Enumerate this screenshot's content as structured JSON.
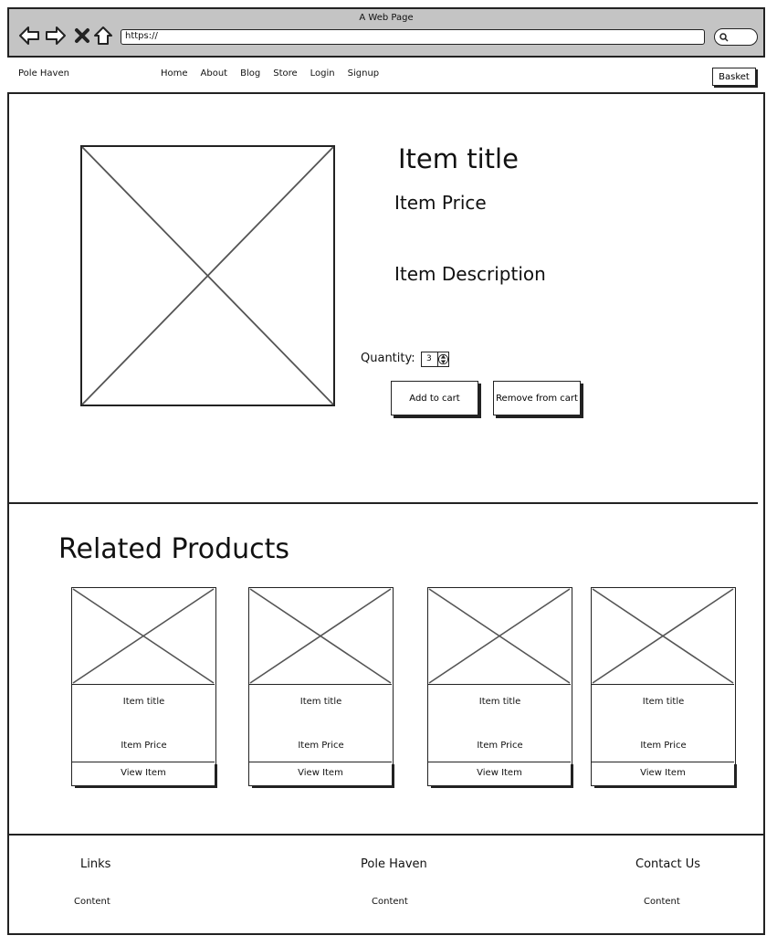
{
  "browser": {
    "window_title": "A Web Page",
    "url": "https://"
  },
  "nav": {
    "brand": "Pole Haven",
    "links": [
      "Home",
      "About",
      "Blog",
      "Store",
      "Login",
      "Signup"
    ],
    "basket_label": "Basket"
  },
  "product": {
    "title": "Item title",
    "price": "Item Price",
    "description": "Item Description",
    "quantity_label": "Quantity:",
    "quantity_value": "3",
    "add_label": "Add to cart",
    "remove_label": "Remove from cart"
  },
  "related": {
    "heading": "Related Products",
    "cards": [
      {
        "title": "Item title",
        "price": "Item Price",
        "view_label": "View Item"
      },
      {
        "title": "Item title",
        "price": "Item Price",
        "view_label": "View Item"
      },
      {
        "title": "Item title",
        "price": "Item Price",
        "view_label": "View Item"
      },
      {
        "title": "Item title",
        "price": "Item Price",
        "view_label": "View Item"
      }
    ]
  },
  "footer": {
    "columns": [
      {
        "heading": "Links",
        "content": "Content"
      },
      {
        "heading": "Pole Haven",
        "content": "Content"
      },
      {
        "heading": "Contact Us",
        "content": "Content"
      }
    ]
  },
  "icons": {
    "back": "back-arrow-icon",
    "forward": "forward-arrow-icon",
    "stop": "close-icon",
    "home": "home-icon",
    "search": "search-icon"
  }
}
